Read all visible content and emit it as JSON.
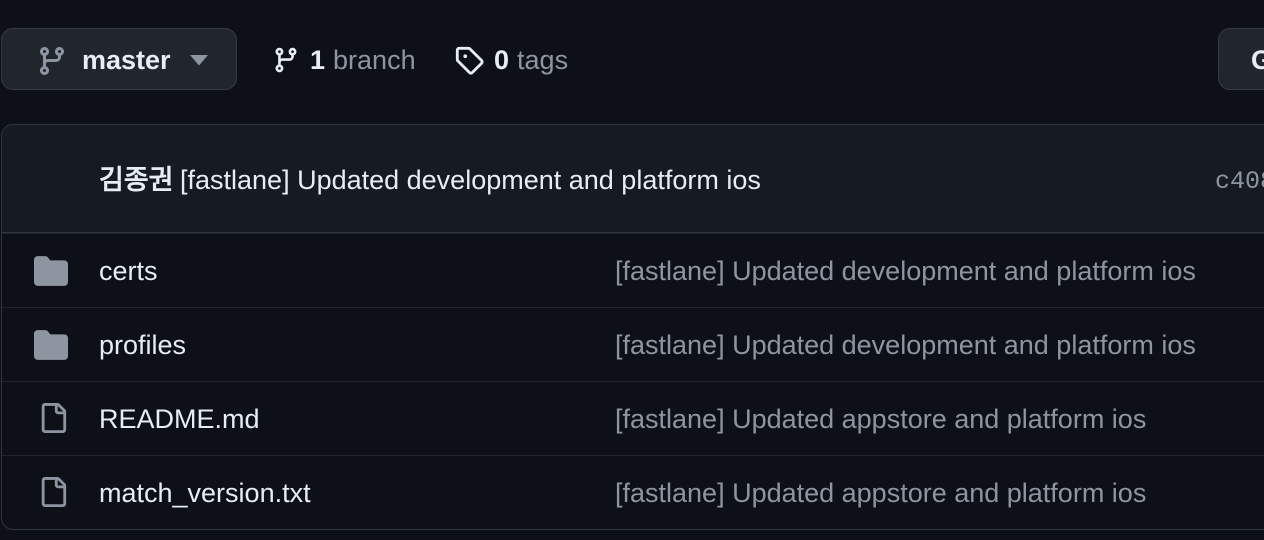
{
  "toolbar": {
    "branch_selector": {
      "label": "master",
      "icon": "git-branch-icon"
    },
    "branches": {
      "count": "1",
      "label": "branch",
      "icon": "git-branch-icon"
    },
    "tags": {
      "count": "0",
      "label": "tags",
      "icon": "tag-icon"
    },
    "right_button_label": "G"
  },
  "latest_commit": {
    "author": "김종권",
    "message": "[fastlane] Updated development and platform ios",
    "sha": "c408"
  },
  "files": [
    {
      "type": "folder",
      "icon": "folder-icon",
      "name": "certs",
      "commit_message": "[fastlane] Updated development and platform ios"
    },
    {
      "type": "folder",
      "icon": "folder-icon",
      "name": "profiles",
      "commit_message": "[fastlane] Updated development and platform ios"
    },
    {
      "type": "file",
      "icon": "file-icon",
      "name": "README.md",
      "commit_message": "[fastlane] Updated appstore and platform ios"
    },
    {
      "type": "file",
      "icon": "file-icon",
      "name": "match_version.txt",
      "commit_message": "[fastlane] Updated appstore and platform ios"
    }
  ],
  "colors": {
    "background": "#0d1117",
    "button_bg": "#21262d",
    "header_row_bg": "#161b22",
    "text_primary": "#e6edf3",
    "text_muted": "#8d96a0",
    "folder_icon": "#8d96a0",
    "border": "#30363d"
  }
}
